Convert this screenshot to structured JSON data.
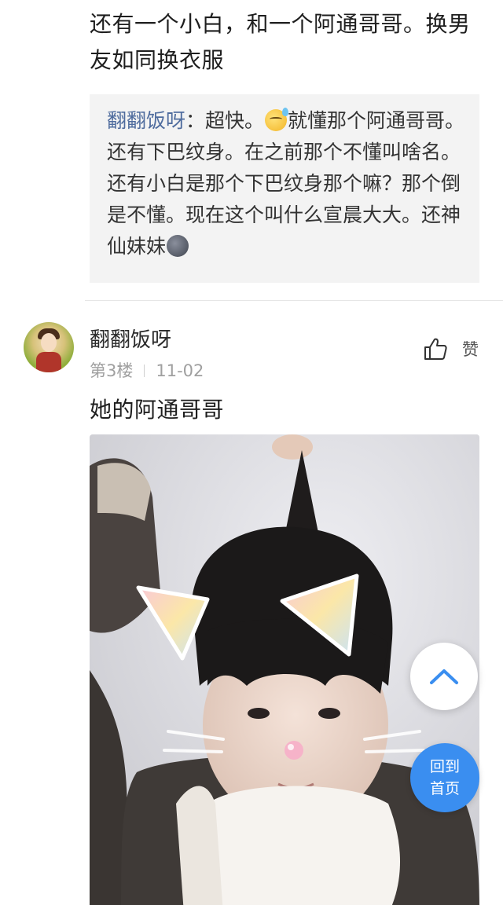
{
  "previous_post": {
    "text": "还有一个小白，和一个阿通哥哥。换男友如同换衣服"
  },
  "quoted_reply": {
    "author": "翻翻饭呀",
    "colon": "：",
    "text_part1": "超快。",
    "emoji1": "sweat-smile-emoji",
    "text_part2": "就懂那个阿通哥哥。还有下巴纹身。在之前那个不懂叫啥名。还有小白是那个下巴纹身那个嘛？那个倒是不懂。现在这个叫什么宣晨大大。还神仙妹妹",
    "emoji2": "new-moon-face-emoji"
  },
  "post": {
    "username": "翻翻饭呀",
    "floor": "第3楼",
    "date": "11-02",
    "like_label": "赞",
    "text": "她的阿通哥哥"
  },
  "buttons": {
    "back_to_top_icon": "chevron-up-icon",
    "home_line1": "回到",
    "home_line2": "首页"
  },
  "colors": {
    "accent_blue": "#3a8ef0",
    "author_link": "#4f6c9e",
    "quote_bg": "#f3f3f3",
    "meta_gray": "#a0a0a0"
  }
}
